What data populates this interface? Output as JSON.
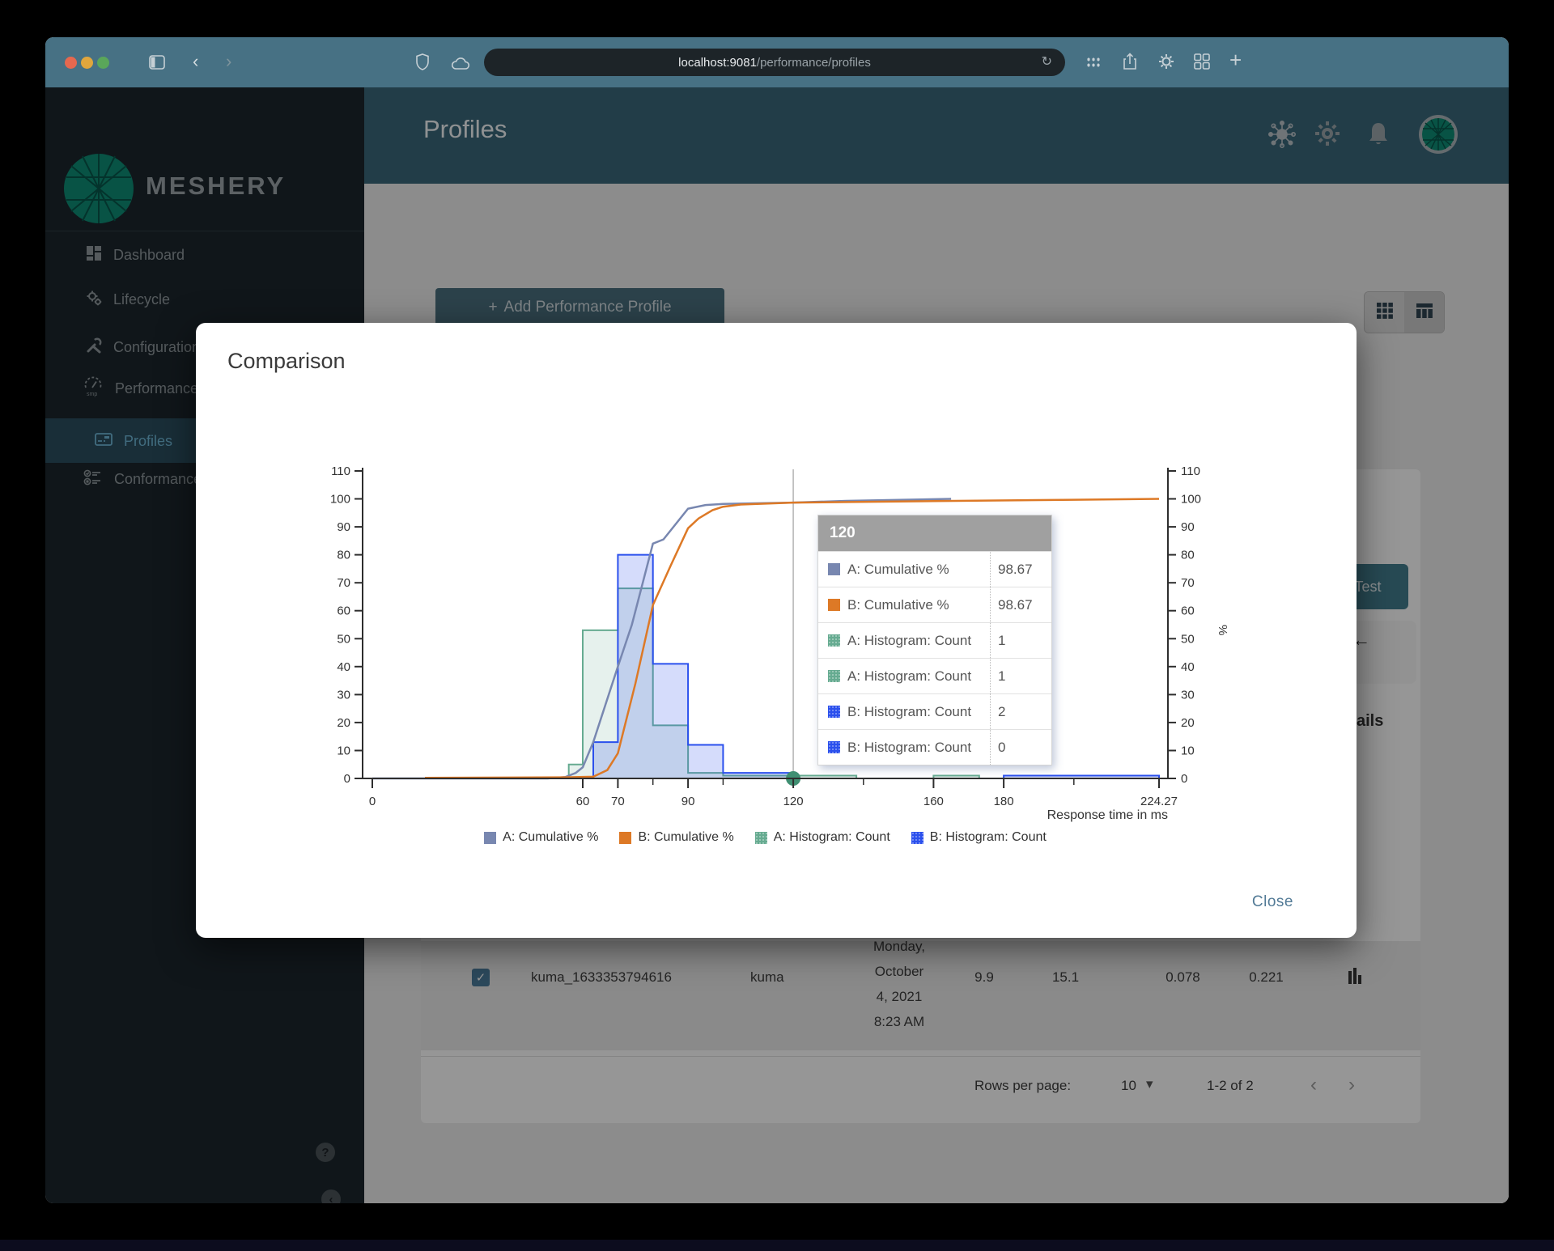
{
  "browser": {
    "url_host": "localhost:9081",
    "url_path": "/performance/profiles",
    "icons": {
      "back": "‹",
      "forward": "›",
      "refresh": "↻",
      "new_tab": "+"
    }
  },
  "app": {
    "brand": "MESHERY",
    "page_title": "Profiles"
  },
  "sidebar": {
    "items": [
      {
        "label": "Dashboard"
      },
      {
        "label": "Lifecycle"
      },
      {
        "label": "Configuration"
      },
      {
        "label": "Performance"
      },
      {
        "label": "Profiles",
        "active": true
      },
      {
        "label": "Conformance"
      }
    ],
    "help_glyph": "?",
    "collapse_glyph": "‹"
  },
  "toolbar": {
    "add_plus": "+",
    "add_label": "Add Performance Profile"
  },
  "background": {
    "test_label": "Test",
    "arrow": "←",
    "details_fragment": "ails"
  },
  "table": {
    "row": {
      "name": "kuma_1633353794616",
      "mesh": "kuma",
      "date_lines": [
        "Monday,",
        "October",
        "4, 2021",
        "8:23 AM"
      ],
      "qps": "9.9",
      "duration": "15.1",
      "p50": "0.078",
      "p99": "0.221"
    }
  },
  "pagination": {
    "rows_per_page_label": "Rows per page:",
    "rows_per_page_value": "10",
    "caret": "▾",
    "range": "1-2 of 2",
    "prev": "‹",
    "next": "›"
  },
  "modal": {
    "title": "Comparison",
    "close_label": "Close"
  },
  "chart_data": {
    "type": "combo",
    "x_axis": {
      "label": "Response time in ms",
      "min": 0,
      "max": 224.27,
      "ticks": [
        {
          "v": 0,
          "l": "0"
        },
        {
          "v": 60,
          "l": "60"
        },
        {
          "v": 70,
          "l": "70"
        },
        {
          "v": 90,
          "l": "90"
        },
        {
          "v": 120,
          "l": "120"
        },
        {
          "v": 160,
          "l": "160"
        },
        {
          "v": 180,
          "l": "180"
        },
        {
          "v": 224.27,
          "l": "224.27"
        }
      ],
      "minor_ticks": [
        80,
        100,
        140,
        200
      ]
    },
    "y_axis": {
      "label": "%",
      "min": 0,
      "max": 110,
      "step": 10,
      "sides": [
        "left",
        "right"
      ]
    },
    "series": [
      {
        "name": "A: Cumulative %",
        "type": "line",
        "color": "#7887b0",
        "points": [
          [
            0,
            0
          ],
          [
            50,
            0
          ],
          [
            55,
            0.5
          ],
          [
            58,
            2
          ],
          [
            60,
            4
          ],
          [
            63,
            13
          ],
          [
            70,
            40
          ],
          [
            74,
            55
          ],
          [
            80,
            84
          ],
          [
            83,
            85.5
          ],
          [
            90,
            96.5
          ],
          [
            95,
            97.8
          ],
          [
            100,
            98.2
          ],
          [
            120,
            98.67
          ],
          [
            135,
            99.3
          ],
          [
            165,
            100
          ]
        ]
      },
      {
        "name": "B: Cumulative %",
        "type": "line",
        "color": "#dd7926",
        "points": [
          [
            15,
            0.2
          ],
          [
            55,
            0.4
          ],
          [
            63,
            0.6
          ],
          [
            67,
            3
          ],
          [
            70,
            9
          ],
          [
            75,
            34
          ],
          [
            80,
            62
          ],
          [
            85,
            76
          ],
          [
            90,
            89.5
          ],
          [
            93,
            93
          ],
          [
            97,
            96
          ],
          [
            100,
            97.2
          ],
          [
            105,
            98
          ],
          [
            120,
            98.67
          ],
          [
            160,
            99.2
          ],
          [
            200,
            99.7
          ],
          [
            224.27,
            100
          ]
        ]
      },
      {
        "name": "A: Histogram: Count",
        "type": "histogram",
        "color": "#66ab91",
        "fill": "rgba(102,171,145,0.16)",
        "steps": [
          [
            56,
            5
          ],
          [
            60,
            53
          ],
          [
            70,
            68
          ],
          [
            80,
            19
          ],
          [
            90,
            2
          ],
          [
            100,
            1
          ],
          [
            138,
            0
          ],
          [
            160,
            1
          ],
          [
            173,
            0
          ]
        ]
      },
      {
        "name": "B: Histogram: Count",
        "type": "histogram",
        "color": "#2b50ed",
        "fill": "rgba(43,80,237,0.20)",
        "steps": [
          [
            63,
            13
          ],
          [
            70,
            80
          ],
          [
            80,
            41
          ],
          [
            90,
            12
          ],
          [
            100,
            2
          ],
          [
            120,
            0
          ],
          [
            180,
            1
          ],
          [
            224.27,
            0
          ]
        ]
      }
    ],
    "crosshair": {
      "x": 120
    },
    "marker": {
      "x": 120,
      "y": 0,
      "color": "#3f8f72"
    },
    "tooltip": {
      "title": "120",
      "rows": [
        {
          "swatch": "slate",
          "label": "A: Cumulative %",
          "value": "98.67"
        },
        {
          "swatch": "orange",
          "label": "B: Cumulative %",
          "value": "98.67"
        },
        {
          "swatch": "green",
          "label": "A: Histogram: Count",
          "value": "1"
        },
        {
          "swatch": "green",
          "label": "A: Histogram: Count",
          "value": "1"
        },
        {
          "swatch": "blue",
          "label": "B: Histogram: Count",
          "value": "2"
        },
        {
          "swatch": "blue",
          "label": "B: Histogram: Count",
          "value": "0"
        }
      ]
    },
    "legend": [
      {
        "swatch": "slate",
        "label": "A: Cumulative %"
      },
      {
        "swatch": "orange",
        "label": "B: Cumulative %"
      },
      {
        "swatch": "green",
        "label": "A: Histogram: Count"
      },
      {
        "swatch": "blue",
        "label": "B: Histogram: Count"
      }
    ]
  }
}
